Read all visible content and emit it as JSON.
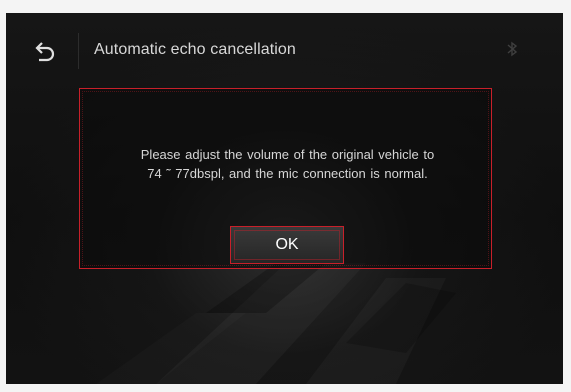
{
  "header": {
    "back_icon": "back-arrow-icon",
    "title": "Automatic echo cancellation",
    "status_icon": "bluetooth-icon"
  },
  "dialog": {
    "message_line1": "Please adjust the volume of the original vehicle to",
    "message_line2": "74 ˜ 77dbspl, and the mic connection is normal.",
    "ok_label": "OK"
  },
  "colors": {
    "accent": "#c8202a",
    "background": "#0e0e0e",
    "text": "#d8d8d8"
  }
}
